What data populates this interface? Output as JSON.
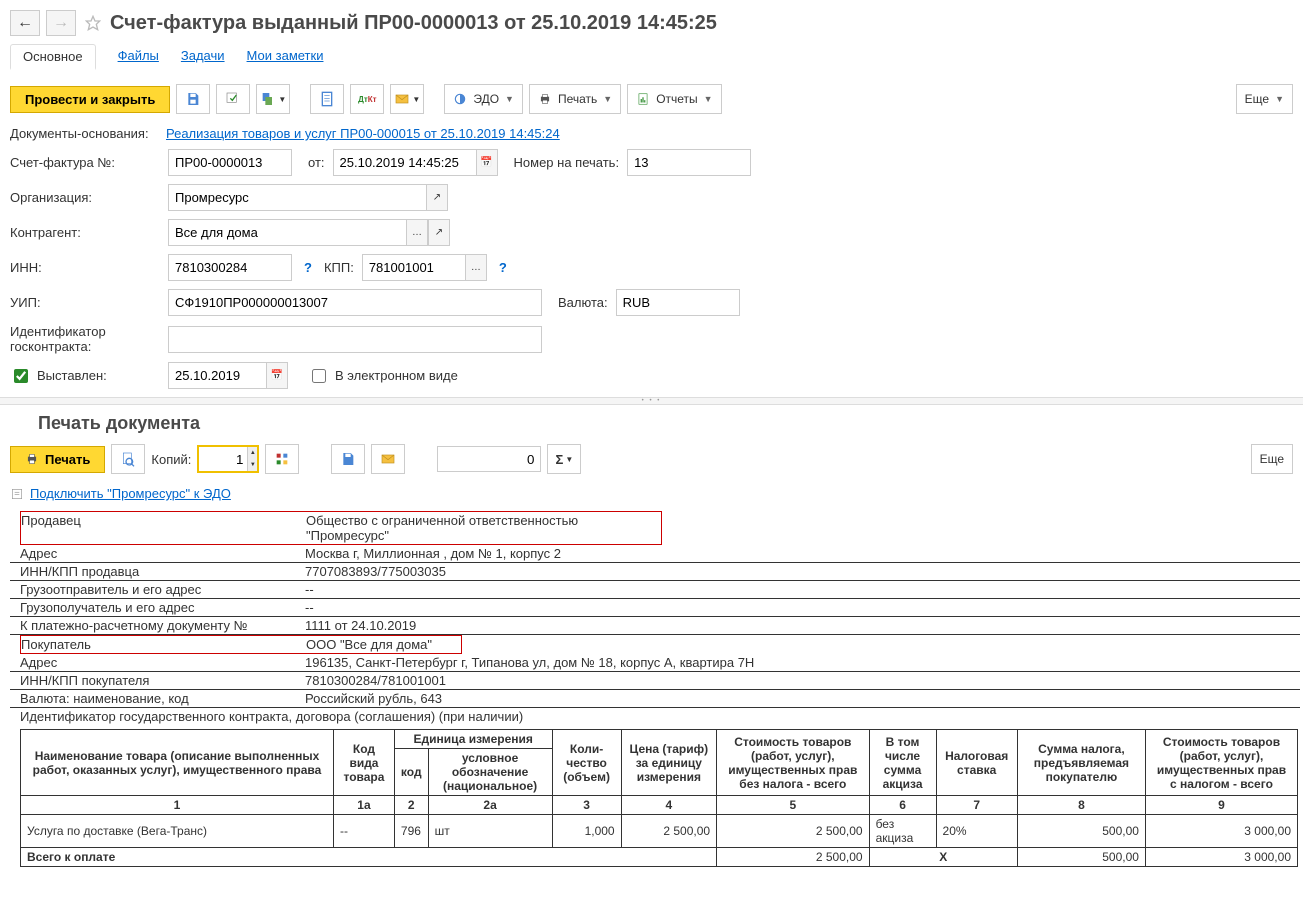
{
  "header": {
    "title": "Счет-фактура выданный ПР00-0000013 от 25.10.2019 14:45:25"
  },
  "tabs": {
    "main": "Основное",
    "files": "Файлы",
    "tasks": "Задачи",
    "notes": "Мои заметки"
  },
  "toolbar": {
    "post_close": "Провести и закрыть",
    "edo": "ЭДО",
    "print": "Печать",
    "reports": "Отчеты",
    "more": "Еще"
  },
  "form": {
    "basis_label": "Документы-основания:",
    "basis_link": "Реализация товаров и услуг ПР00-000015 от 25.10.2019 14:45:24",
    "num_label": "Счет-фактура №:",
    "num": "ПР00-0000013",
    "from_label": "от:",
    "datetime": "25.10.2019 14:45:25",
    "print_num_label": "Номер на печать:",
    "print_num": "13",
    "org_label": "Организация:",
    "org": "Промресурс",
    "counterparty_label": "Контрагент:",
    "counterparty": "Все для дома",
    "inn_label": "ИНН:",
    "inn": "7810300284",
    "kpp_label": "КПП:",
    "kpp": "781001001",
    "uip_label": "УИП:",
    "uip": "СФ1910ПР000000013007",
    "currency_label": "Валюта:",
    "currency": "RUB",
    "contract_id_label": "Идентификатор госконтракта:",
    "issued_label": "Выставлен:",
    "issued_date": "25.10.2019",
    "electronic_label": "В электронном виде"
  },
  "print_section": {
    "title": "Печать документа",
    "print_btn": "Печать",
    "copies_label": "Копий:",
    "copies": "1",
    "sum_input": "0",
    "more": "Еще",
    "edo_link": "Подключить \"Промресурс\" к ЭДО"
  },
  "invoice": {
    "seller_label": "Продавец",
    "seller": "Общество с ограниченной ответственностью \"Промресурс\"",
    "address_label": "Адрес",
    "address": "Москва г, Миллионная , дом № 1, корпус 2",
    "inn_kpp_seller_label": "ИНН/КПП продавца",
    "inn_kpp_seller": "7707083893/775003035",
    "shipper_label": "Грузоотправитель и его адрес",
    "shipper": "--",
    "consignee_label": "Грузополучатель и его адрес",
    "consignee": "--",
    "payment_doc_label": "К платежно-расчетному документу №",
    "payment_doc": "1111 от 24.10.2019",
    "buyer_label": "Покупатель",
    "buyer": "ООО \"Все для дома\"",
    "buyer_address_label": "Адрес",
    "buyer_address": "196135, Санкт-Петербург г, Типанова ул, дом № 18, корпус А, квартира 7Н",
    "buyer_inn_kpp_label": "ИНН/КПП покупателя",
    "buyer_inn_kpp": "7810300284/781001001",
    "currency_row_label": "Валюта: наименование, код",
    "currency_row": "Российский рубль, 643",
    "contract_row": "Идентификатор государственного контракта, договора (соглашения) (при наличии)"
  },
  "table": {
    "headers": {
      "name": "Наименование товара (описание выполненных работ, оказанных услуг), имущественного права",
      "code_type": "Код вида товара",
      "unit": "Единица измерения",
      "unit_code": "код",
      "unit_symbol": "условное обозначение (национальное)",
      "qty": "Коли-чество (объем)",
      "price": "Цена (тариф) за единицу измерения",
      "cost_no_tax": "Стоимость товаров (работ, услуг), имущественных прав без налога - всего",
      "excise": "В том числе сумма акциза",
      "tax_rate": "Налоговая ставка",
      "tax_sum": "Сумма налога, предъявляемая покупателю",
      "cost_with_tax": "Стоимость товаров (работ, услуг), имущественных прав с налогом - всего"
    },
    "col_nums": [
      "1",
      "1а",
      "2",
      "2а",
      "3",
      "4",
      "5",
      "6",
      "7",
      "8",
      "9"
    ],
    "row": {
      "name": "Услуга по доставке (Вега-Транс)",
      "code_type": "--",
      "unit_code": "796",
      "unit_symbol": "шт",
      "qty": "1,000",
      "price": "2 500,00",
      "cost_no_tax": "2 500,00",
      "excise": "без акциза",
      "tax_rate": "20%",
      "tax_sum": "500,00",
      "cost_with_tax": "3 000,00"
    },
    "total": {
      "label": "Всего к оплате",
      "cost_no_tax": "2 500,00",
      "excise": "Х",
      "tax_sum": "500,00",
      "cost_with_tax": "3 000,00"
    }
  }
}
